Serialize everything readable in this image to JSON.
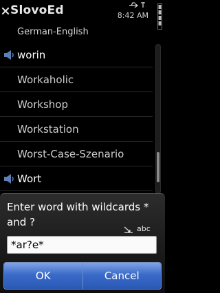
{
  "app": {
    "title": "SlovoEd",
    "time": "8:42 AM"
  },
  "dictionary": {
    "name": "German-English"
  },
  "list": {
    "items": [
      {
        "label": "worin",
        "speaker": true
      },
      {
        "label": "Workaholic",
        "speaker": false
      },
      {
        "label": "Workshop",
        "speaker": false
      },
      {
        "label": "Workstation",
        "speaker": false
      },
      {
        "label": "Worst-Case-Szenario",
        "speaker": false
      },
      {
        "label": "Wort",
        "speaker": true
      }
    ]
  },
  "dialog": {
    "prompt": "Enter word with wildcards * and ?",
    "input_mode": "abc",
    "input_value": "*ar?e*",
    "ok_label": "OK",
    "cancel_label": "Cancel"
  },
  "icons": {
    "close": "close-icon",
    "usb": "usb-icon",
    "signal": "signal-icon",
    "battery": "battery-icon",
    "speaker": "speaker-icon",
    "pen": "predictive-input-icon"
  },
  "colors": {
    "background": "#000000",
    "softkey": "#3a6bc9",
    "input_bg": "#fafafa"
  }
}
